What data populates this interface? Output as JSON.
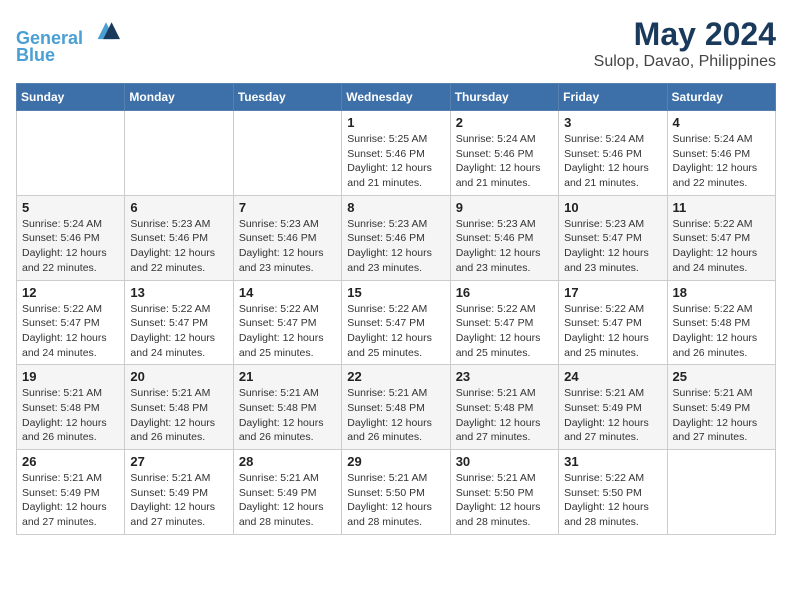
{
  "header": {
    "logo_line1": "General",
    "logo_line2": "Blue",
    "main_title": "May 2024",
    "subtitle": "Sulop, Davao, Philippines"
  },
  "weekdays": [
    "Sunday",
    "Monday",
    "Tuesday",
    "Wednesday",
    "Thursday",
    "Friday",
    "Saturday"
  ],
  "weeks": [
    [
      {
        "day": "",
        "info": ""
      },
      {
        "day": "",
        "info": ""
      },
      {
        "day": "",
        "info": ""
      },
      {
        "day": "1",
        "info": "Sunrise: 5:25 AM\nSunset: 5:46 PM\nDaylight: 12 hours\nand 21 minutes."
      },
      {
        "day": "2",
        "info": "Sunrise: 5:24 AM\nSunset: 5:46 PM\nDaylight: 12 hours\nand 21 minutes."
      },
      {
        "day": "3",
        "info": "Sunrise: 5:24 AM\nSunset: 5:46 PM\nDaylight: 12 hours\nand 21 minutes."
      },
      {
        "day": "4",
        "info": "Sunrise: 5:24 AM\nSunset: 5:46 PM\nDaylight: 12 hours\nand 22 minutes."
      }
    ],
    [
      {
        "day": "5",
        "info": "Sunrise: 5:24 AM\nSunset: 5:46 PM\nDaylight: 12 hours\nand 22 minutes."
      },
      {
        "day": "6",
        "info": "Sunrise: 5:23 AM\nSunset: 5:46 PM\nDaylight: 12 hours\nand 22 minutes."
      },
      {
        "day": "7",
        "info": "Sunrise: 5:23 AM\nSunset: 5:46 PM\nDaylight: 12 hours\nand 23 minutes."
      },
      {
        "day": "8",
        "info": "Sunrise: 5:23 AM\nSunset: 5:46 PM\nDaylight: 12 hours\nand 23 minutes."
      },
      {
        "day": "9",
        "info": "Sunrise: 5:23 AM\nSunset: 5:46 PM\nDaylight: 12 hours\nand 23 minutes."
      },
      {
        "day": "10",
        "info": "Sunrise: 5:23 AM\nSunset: 5:47 PM\nDaylight: 12 hours\nand 23 minutes."
      },
      {
        "day": "11",
        "info": "Sunrise: 5:22 AM\nSunset: 5:47 PM\nDaylight: 12 hours\nand 24 minutes."
      }
    ],
    [
      {
        "day": "12",
        "info": "Sunrise: 5:22 AM\nSunset: 5:47 PM\nDaylight: 12 hours\nand 24 minutes."
      },
      {
        "day": "13",
        "info": "Sunrise: 5:22 AM\nSunset: 5:47 PM\nDaylight: 12 hours\nand 24 minutes."
      },
      {
        "day": "14",
        "info": "Sunrise: 5:22 AM\nSunset: 5:47 PM\nDaylight: 12 hours\nand 25 minutes."
      },
      {
        "day": "15",
        "info": "Sunrise: 5:22 AM\nSunset: 5:47 PM\nDaylight: 12 hours\nand 25 minutes."
      },
      {
        "day": "16",
        "info": "Sunrise: 5:22 AM\nSunset: 5:47 PM\nDaylight: 12 hours\nand 25 minutes."
      },
      {
        "day": "17",
        "info": "Sunrise: 5:22 AM\nSunset: 5:47 PM\nDaylight: 12 hours\nand 25 minutes."
      },
      {
        "day": "18",
        "info": "Sunrise: 5:22 AM\nSunset: 5:48 PM\nDaylight: 12 hours\nand 26 minutes."
      }
    ],
    [
      {
        "day": "19",
        "info": "Sunrise: 5:21 AM\nSunset: 5:48 PM\nDaylight: 12 hours\nand 26 minutes."
      },
      {
        "day": "20",
        "info": "Sunrise: 5:21 AM\nSunset: 5:48 PM\nDaylight: 12 hours\nand 26 minutes."
      },
      {
        "day": "21",
        "info": "Sunrise: 5:21 AM\nSunset: 5:48 PM\nDaylight: 12 hours\nand 26 minutes."
      },
      {
        "day": "22",
        "info": "Sunrise: 5:21 AM\nSunset: 5:48 PM\nDaylight: 12 hours\nand 26 minutes."
      },
      {
        "day": "23",
        "info": "Sunrise: 5:21 AM\nSunset: 5:48 PM\nDaylight: 12 hours\nand 27 minutes."
      },
      {
        "day": "24",
        "info": "Sunrise: 5:21 AM\nSunset: 5:49 PM\nDaylight: 12 hours\nand 27 minutes."
      },
      {
        "day": "25",
        "info": "Sunrise: 5:21 AM\nSunset: 5:49 PM\nDaylight: 12 hours\nand 27 minutes."
      }
    ],
    [
      {
        "day": "26",
        "info": "Sunrise: 5:21 AM\nSunset: 5:49 PM\nDaylight: 12 hours\nand 27 minutes."
      },
      {
        "day": "27",
        "info": "Sunrise: 5:21 AM\nSunset: 5:49 PM\nDaylight: 12 hours\nand 27 minutes."
      },
      {
        "day": "28",
        "info": "Sunrise: 5:21 AM\nSunset: 5:49 PM\nDaylight: 12 hours\nand 28 minutes."
      },
      {
        "day": "29",
        "info": "Sunrise: 5:21 AM\nSunset: 5:50 PM\nDaylight: 12 hours\nand 28 minutes."
      },
      {
        "day": "30",
        "info": "Sunrise: 5:21 AM\nSunset: 5:50 PM\nDaylight: 12 hours\nand 28 minutes."
      },
      {
        "day": "31",
        "info": "Sunrise: 5:22 AM\nSunset: 5:50 PM\nDaylight: 12 hours\nand 28 minutes."
      },
      {
        "day": "",
        "info": ""
      }
    ]
  ]
}
